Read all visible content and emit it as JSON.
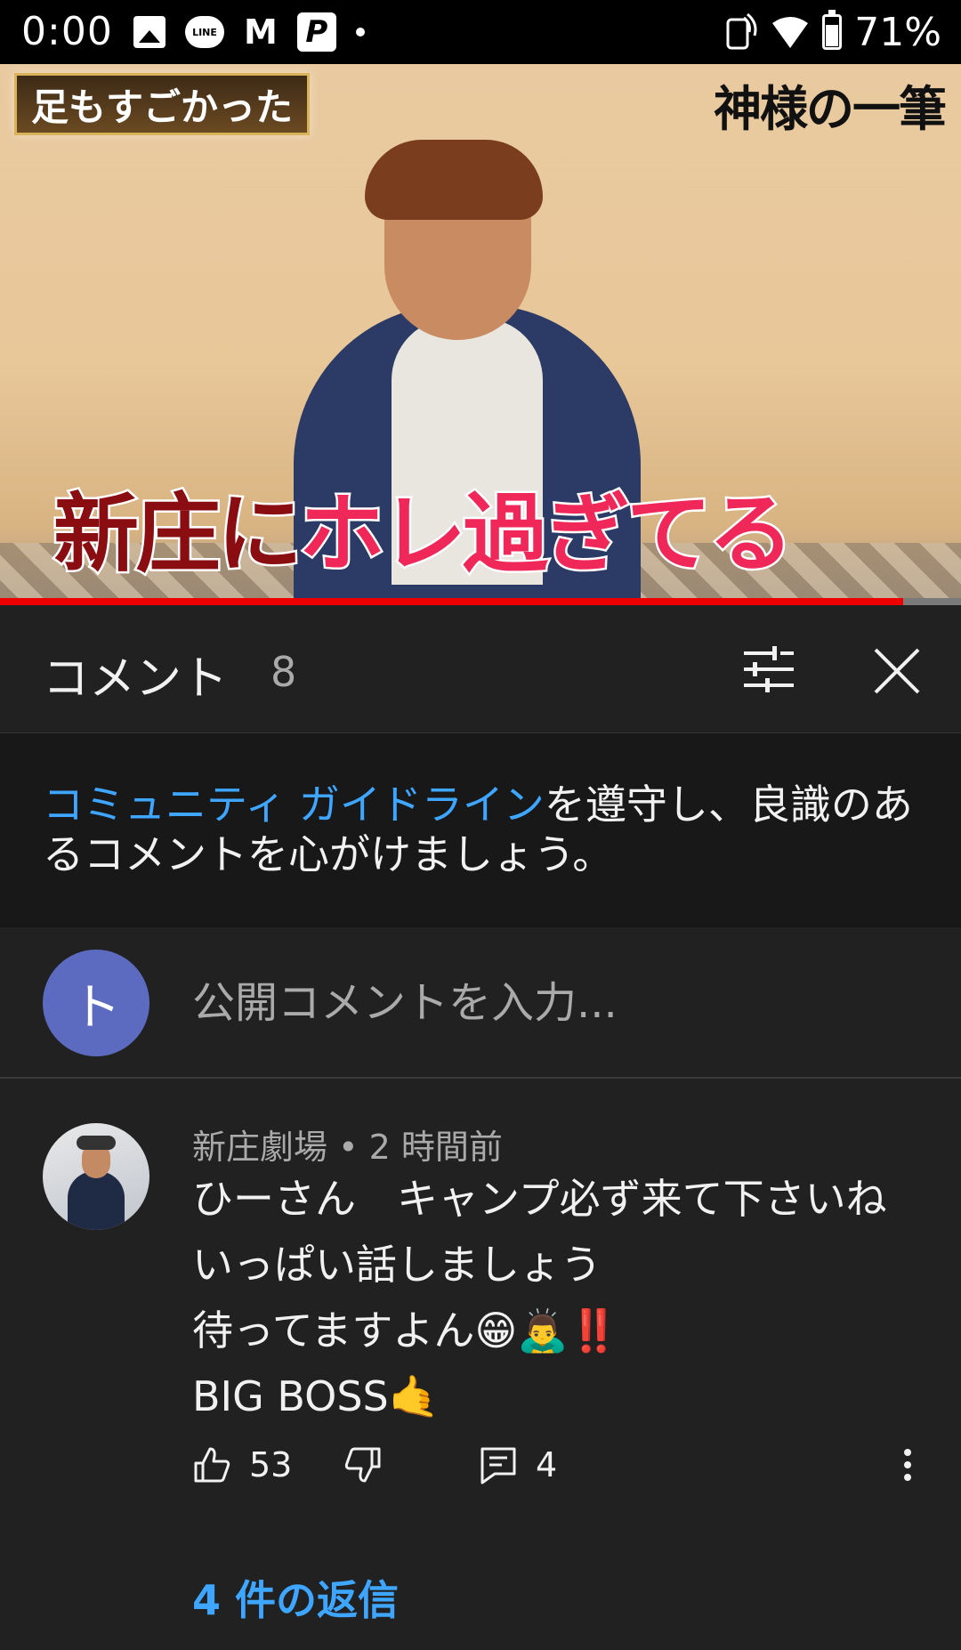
{
  "status_bar": {
    "time": "0:00",
    "battery": "71%",
    "left_icons": [
      "image-icon",
      "line-icon",
      "gmail-icon",
      "p-app-icon",
      "dot-icon"
    ],
    "right_icons": [
      "nfc-icon",
      "wifi-icon",
      "battery-icon"
    ]
  },
  "video": {
    "badge": "足もすごかった",
    "logo": "神様の一筆",
    "caption_part1": "新庄に",
    "caption_part2": "ホレ過ぎてる",
    "progress": 0.94
  },
  "comments_panel": {
    "title": "コメント",
    "count": "8",
    "filter_icon": "sliders-icon",
    "close_icon": "close-icon"
  },
  "guideline": {
    "link": "コミュニティ ガイドライン",
    "text": "を遵守し、良識のあるコメントを心がけましょう。"
  },
  "comment_input": {
    "avatar_initial": "ト",
    "placeholder": "公開コメントを入力..."
  },
  "comment": {
    "author": "新庄劇場",
    "separator": " • ",
    "time": "2 時間前",
    "text": "ひーさん　キャンプ必ず来て下さいね\nいっぱい話しましょう\n待ってますよん😁🙇‍♂️‼️\nBIG BOSS🤙",
    "likes": "53",
    "replies_count": "4",
    "replies_link": "4 件の返信"
  }
}
